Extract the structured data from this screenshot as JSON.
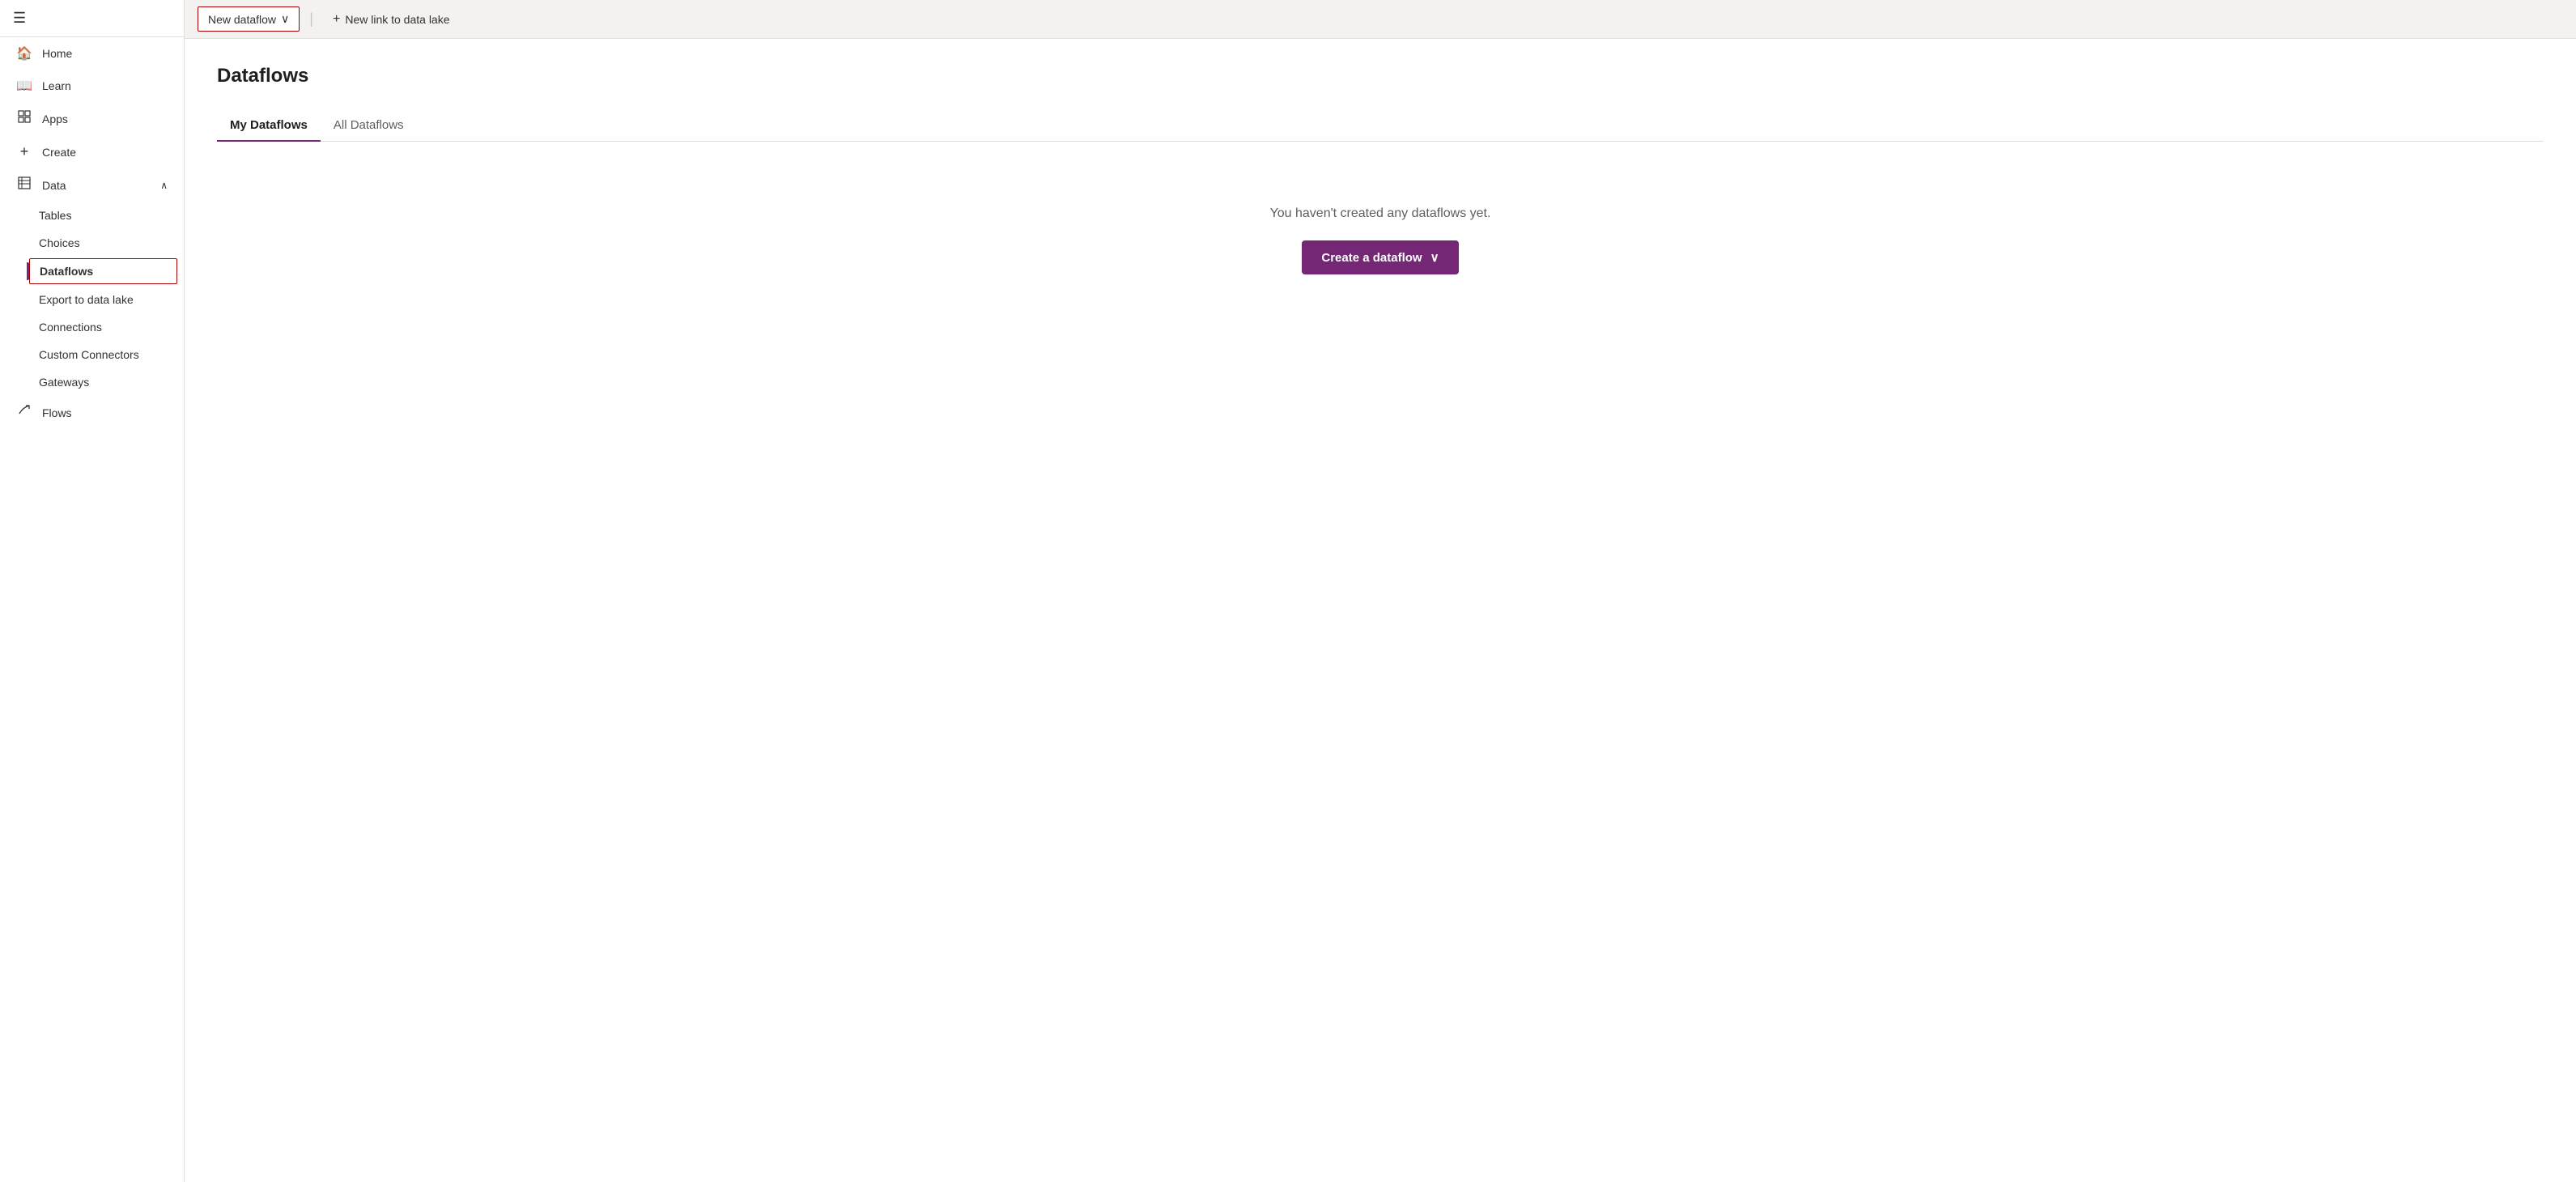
{
  "sidebar": {
    "hamburger_label": "☰",
    "items": [
      {
        "id": "home",
        "label": "Home",
        "icon": "🏠"
      },
      {
        "id": "learn",
        "label": "Learn",
        "icon": "📖"
      },
      {
        "id": "apps",
        "label": "Apps",
        "icon": "➕"
      },
      {
        "id": "create",
        "label": "Create",
        "icon": "➕"
      },
      {
        "id": "data",
        "label": "Data",
        "icon": "⊞",
        "expandable": true,
        "expanded": true
      }
    ],
    "data_sub_items": [
      {
        "id": "tables",
        "label": "Tables"
      },
      {
        "id": "choices",
        "label": "Choices"
      },
      {
        "id": "dataflows",
        "label": "Dataflows",
        "active": true
      },
      {
        "id": "export-to-data-lake",
        "label": "Export to data lake"
      },
      {
        "id": "connections",
        "label": "Connections"
      },
      {
        "id": "custom-connectors",
        "label": "Custom Connectors"
      },
      {
        "id": "gateways",
        "label": "Gateways"
      }
    ],
    "bottom_items": [
      {
        "id": "flows",
        "label": "Flows",
        "icon": "↗"
      }
    ]
  },
  "toolbar": {
    "new_dataflow_label": "New dataflow",
    "new_dataflow_chevron": "∨",
    "separator": "|",
    "new_link_icon": "+",
    "new_link_label": "New link to data lake"
  },
  "page": {
    "title": "Dataflows",
    "tabs": [
      {
        "id": "my-dataflows",
        "label": "My Dataflows",
        "active": true
      },
      {
        "id": "all-dataflows",
        "label": "All Dataflows",
        "active": false
      }
    ],
    "empty_state_text": "You haven't created any dataflows yet.",
    "create_btn_label": "Create a dataflow",
    "create_btn_chevron": "∨"
  }
}
